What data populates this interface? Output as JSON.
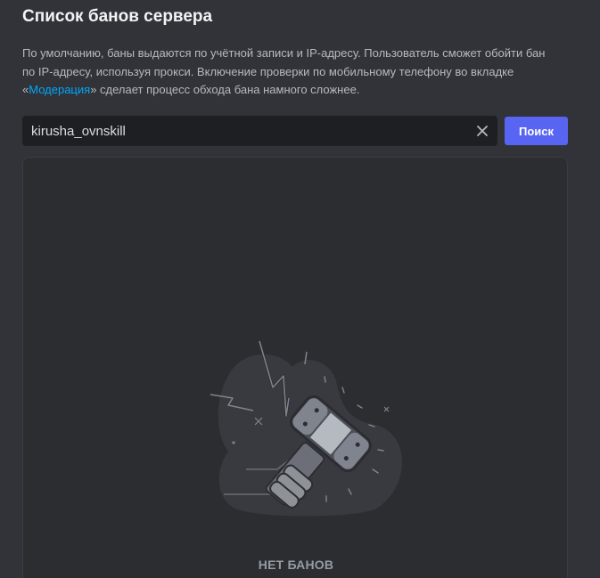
{
  "page": {
    "title": "Список банов сервера"
  },
  "description": {
    "text_before": "По умолчанию, баны выдаются по учётной записи и IP-адресу. Пользователь сможет обойти бан по IP-адресу, используя прокси. Включение проверки по мобильному телефону во вкладке «",
    "link_text": "Модерация",
    "text_after": "» сделает процесс обхода бана намного сложнее."
  },
  "search": {
    "value": "kirusha_ovnskill",
    "clear_icon": "close-icon",
    "button_label": "Поиск"
  },
  "empty_state": {
    "illustration": "ban-hammer-illustration",
    "label": "НЕТ БАНОВ"
  },
  "colors": {
    "background": "#313338",
    "panel": "#2b2d31",
    "input": "#1e1f22",
    "accent": "#5865f2",
    "link": "#00a8fc"
  }
}
